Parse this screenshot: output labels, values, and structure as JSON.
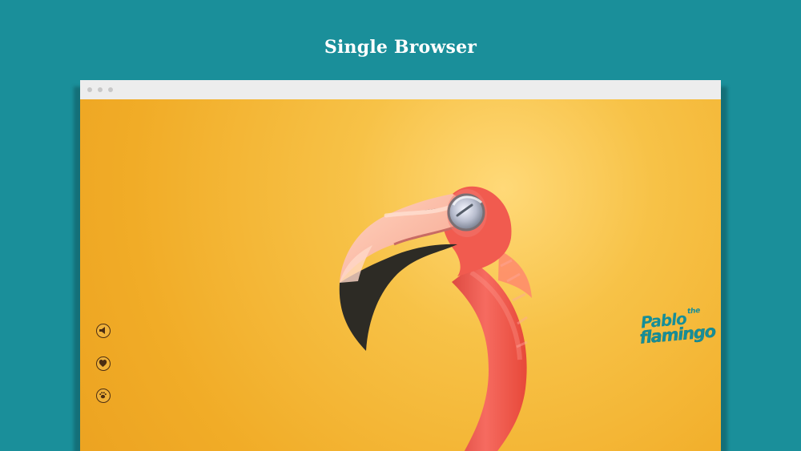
{
  "page": {
    "title": "Single Browser"
  },
  "browser": {
    "window_dots": [
      "window-dot",
      "window-dot",
      "window-dot"
    ]
  },
  "viewport": {
    "icons": {
      "sound": "speaker-icon",
      "favorite": "heart-icon",
      "paw": "paw-icon",
      "illustration": "flamingo-illustration"
    },
    "logo": {
      "line1": "Pablo",
      "line2": "the",
      "line3": "flamingo"
    }
  },
  "colors": {
    "page_background": "#1a8f9a",
    "title_text": "#ffffff",
    "viewport_background": "#f1ac27",
    "flamingo_pink": "#f26f62",
    "logo_teal": "#168e98",
    "control_brown": "#4b2d12"
  }
}
